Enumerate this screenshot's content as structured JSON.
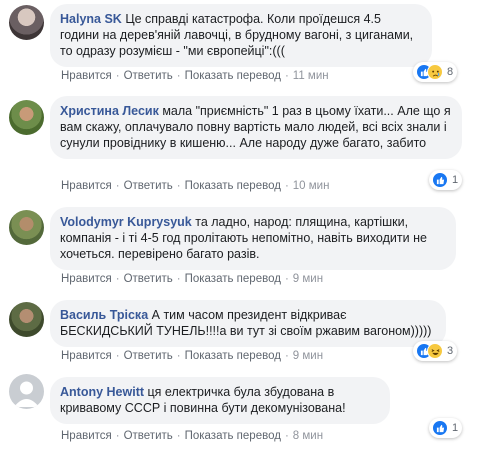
{
  "colors": {
    "author": "#385898",
    "bubble": "#f2f3f5",
    "action": "#606770",
    "like": "#1877f2"
  },
  "action_labels": {
    "like": "Нравится",
    "reply": "Ответить",
    "translate": "Показать перевод"
  },
  "comments": [
    {
      "author": "Halyna SK",
      "text": "Це справді катастрофа. Коли проїдешся 4.5 години на дерев'яній лавочці, в брудному вагоні, з циганами, то одразу розумієш - \"ми європейці\":(((",
      "time": "11 мин",
      "reactions": [
        "like-icon",
        "sad-icon"
      ],
      "reaction_count": "8"
    },
    {
      "author": "Христина Лесик",
      "text": "мала \"приємність\" 1 раз в цьому їхати... Але що я вам скажу, оплачувало повну вартість мало людей, всі всіх знали і сунули провіднику в кишеню... Але народу дуже багато, забито",
      "time": "10 мин",
      "reactions": [
        "like-icon"
      ],
      "reaction_count": "1"
    },
    {
      "author": "Volodymyr Kuprysyuk",
      "text": "та ладно, народ: плящина, картішки, компанія - і ті 4-5 год пролітають непомітно, навіть виходити не хочеться. перевірено багато разів.",
      "time": "9 мин",
      "reactions": [],
      "reaction_count": ""
    },
    {
      "author": "Василь Тріска",
      "text": "А тим часом президент відкриває БЕСКИДСЬКИЙ ТУНЕЛЬ!!!!а ви тут зі своїм ржавим вагоном)))))",
      "time": "9 мин",
      "reactions": [
        "like-icon",
        "haha-icon"
      ],
      "reaction_count": "3"
    },
    {
      "author": "Antony Hewitt",
      "text": "ця електричка була збудована в кривавому СССР і повинна бути декомунізована!",
      "time": "8 мин",
      "reactions": [
        "like-icon"
      ],
      "reaction_count": "1"
    }
  ]
}
